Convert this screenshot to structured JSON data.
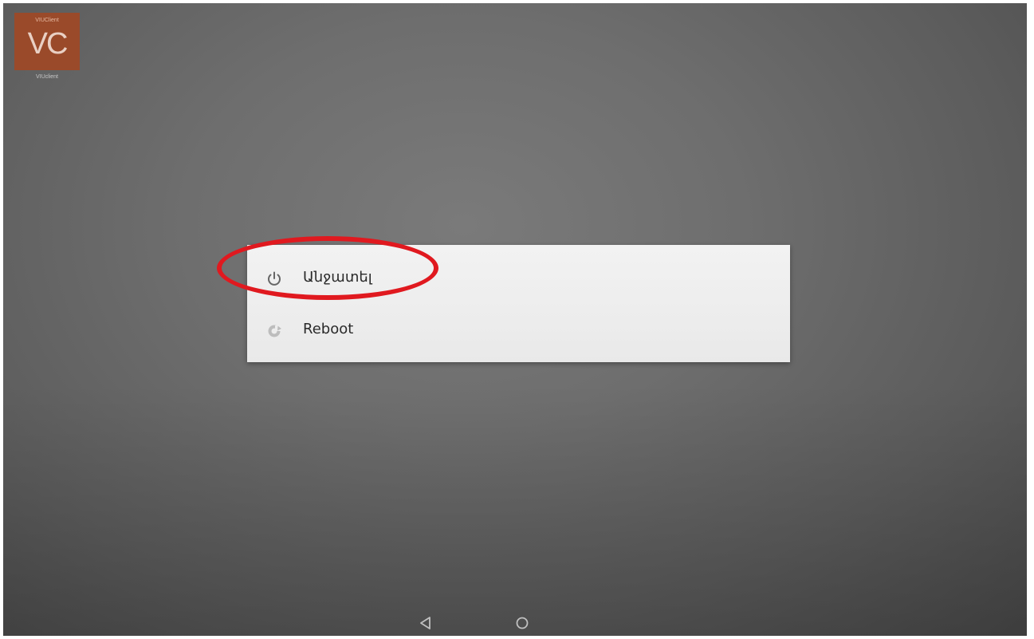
{
  "home_screen": {
    "app_icon": {
      "small_text": "VIUClient",
      "initials": "VC",
      "label": "VIUclient",
      "color": "#9a4a2a"
    }
  },
  "power_menu": {
    "items": [
      {
        "label": "Անջատել",
        "icon": "power-icon"
      },
      {
        "label": "Reboot",
        "icon": "reboot-icon"
      }
    ]
  },
  "annotation": {
    "highlight_color": "#e0191f",
    "highlighted_item": "Անջատել"
  },
  "navigation_bar": {
    "buttons": [
      {
        "icon": "back-icon"
      },
      {
        "icon": "home-icon"
      }
    ]
  }
}
